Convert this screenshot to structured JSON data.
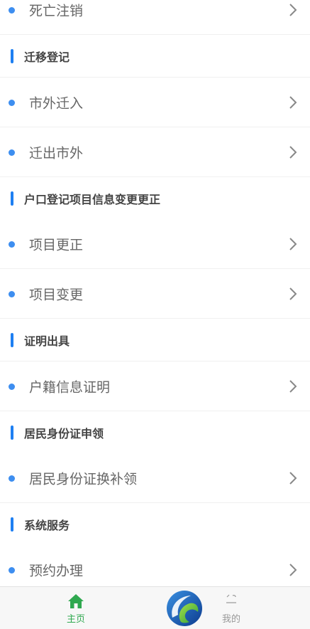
{
  "items": {
    "death": "死亡注销",
    "move_in": "市外迁入",
    "move_out": "迁出市外",
    "correct": "项目更正",
    "change": "项目变更",
    "household_cert": "户籍信息证明",
    "id_replace": "居民身份证换补领",
    "appointment": "预约办理"
  },
  "sections": {
    "migration": "迁移登记",
    "household_info": "户口登记项目信息变更更正",
    "certificate": "证明出具",
    "id_card": "居民身份证申领",
    "system": "系统服务"
  },
  "tabbar": {
    "home": "主页",
    "mine": "我的"
  },
  "colors": {
    "accent_blue": "#1e7ff2",
    "dot_blue": "#3d8ef0",
    "home_green": "#2fa84f"
  }
}
